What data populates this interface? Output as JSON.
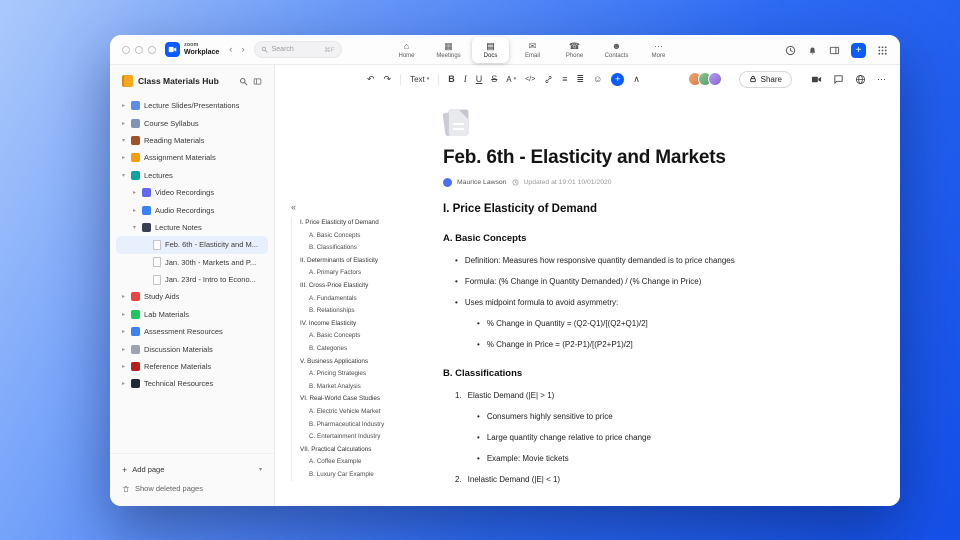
{
  "topbar": {
    "brand": {
      "line1": "zoom",
      "line2": "Workplace"
    },
    "nav_back": "‹",
    "nav_forward": "›",
    "search": {
      "placeholder": "Search",
      "shortcut": "⌘F"
    },
    "plus": "+",
    "tabs": [
      {
        "id": "home",
        "label": "Home",
        "icon": "⌂",
        "active": false
      },
      {
        "id": "meetings",
        "label": "Meetings",
        "icon": "▦",
        "active": false
      },
      {
        "id": "docs",
        "label": "Docs",
        "icon": "▤",
        "active": true
      },
      {
        "id": "email",
        "label": "Email",
        "icon": "✉",
        "active": false
      },
      {
        "id": "phone",
        "label": "Phone",
        "icon": "☎",
        "active": false
      },
      {
        "id": "contacts",
        "label": "Contacts",
        "icon": "☻",
        "active": false
      },
      {
        "id": "more",
        "label": "More",
        "icon": "⋯",
        "active": false
      }
    ]
  },
  "sidebar": {
    "title": "Class Materials Hub",
    "items": [
      {
        "label": "Lecture Slides/Presentations",
        "level": 0,
        "chevron": "right",
        "icon": "slides",
        "selected": false
      },
      {
        "label": "Course Syllabus",
        "level": 0,
        "chevron": "right",
        "icon": "syllabus",
        "selected": false
      },
      {
        "label": "Reading Materials",
        "level": 0,
        "chevron": "down",
        "icon": "reading",
        "selected": false
      },
      {
        "label": "Assignment Materials",
        "level": 0,
        "chevron": "right",
        "icon": "assignment",
        "selected": false
      },
      {
        "label": "Lectures",
        "level": 0,
        "chevron": "down",
        "icon": "lectures",
        "selected": false
      },
      {
        "label": "Video Recordings",
        "level": 1,
        "chevron": "right",
        "icon": "video",
        "selected": false
      },
      {
        "label": "Audio Recordings",
        "level": 1,
        "chevron": "right",
        "icon": "audio",
        "selected": false
      },
      {
        "label": "Lecture Notes",
        "level": 1,
        "chevron": "down",
        "icon": "notes",
        "selected": false
      },
      {
        "label": "Feb. 6th - Elasticity and M...",
        "level": 2,
        "chevron": null,
        "icon": "doc",
        "selected": true
      },
      {
        "label": "Jan. 30th - Markets and P...",
        "level": 2,
        "chevron": null,
        "icon": "doc",
        "selected": false
      },
      {
        "label": "Jan. 23rd - Intro to Econo...",
        "level": 2,
        "chevron": null,
        "icon": "doc",
        "selected": false
      },
      {
        "label": "Study Aids",
        "level": 0,
        "chevron": "right",
        "icon": "study",
        "selected": false
      },
      {
        "label": "Lab Materials",
        "level": 0,
        "chevron": "right",
        "icon": "lab",
        "selected": false
      },
      {
        "label": "Assessment Resources",
        "level": 0,
        "chevron": "right",
        "icon": "assessment",
        "selected": false
      },
      {
        "label": "Discussion Materials",
        "level": 0,
        "chevron": "right",
        "icon": "discussion",
        "selected": false
      },
      {
        "label": "Reference Materials",
        "level": 0,
        "chevron": "right",
        "icon": "reference",
        "selected": false
      },
      {
        "label": "Technical Resources",
        "level": 0,
        "chevron": "right",
        "icon": "technical",
        "selected": false
      }
    ],
    "footer": {
      "add_icon": "+",
      "add_page": "Add page",
      "caret": "▾",
      "show_deleted": "Show deleted pages"
    }
  },
  "doc_toolbar": {
    "undo": "↶",
    "redo": "↷",
    "text_style": "Text",
    "caret": "▾",
    "bold": "B",
    "italic": "I",
    "underline": "U",
    "strike": "S",
    "color": "A",
    "code": "</>",
    "list": "≡",
    "align": "≣",
    "emoji": "☺",
    "plus": "+",
    "collapse": "∧",
    "share": "Share",
    "more": "⋯"
  },
  "doc": {
    "title": "Feb. 6th - Elasticity and Markets",
    "author": "Maurice Lawson",
    "updated": "Updated at 19:01 10/01/2020",
    "outline_collapse": "«",
    "outline": [
      {
        "text": "I. Price Elasticity of Demand",
        "level": 0
      },
      {
        "text": "A. Basic Concepts",
        "level": 1
      },
      {
        "text": "B. Classifications",
        "level": 1
      },
      {
        "text": "II. Determinants of Elasticity",
        "level": 0
      },
      {
        "text": "A. Primary Factors",
        "level": 1
      },
      {
        "text": "III. Cross-Price Elasticity",
        "level": 0
      },
      {
        "text": "A. Fundamentals",
        "level": 1
      },
      {
        "text": "B. Relationships",
        "level": 1
      },
      {
        "text": "IV. Income Elasticity",
        "level": 0
      },
      {
        "text": "A. Basic Concepts",
        "level": 1
      },
      {
        "text": "B. Categories",
        "level": 1
      },
      {
        "text": "V. Business Applications",
        "level": 0
      },
      {
        "text": "A. Pricing Strategies",
        "level": 1
      },
      {
        "text": "B. Market Analysis",
        "level": 1
      },
      {
        "text": "VI. Real-World Case Studies",
        "level": 0
      },
      {
        "text": "A. Electric Vehicle Market",
        "level": 1
      },
      {
        "text": "B. Pharmaceutical Industry",
        "level": 1
      },
      {
        "text": "C. Entertainment Industry",
        "level": 1
      },
      {
        "text": "VII. Practical Calculations",
        "level": 0
      },
      {
        "text": "A. Coffee Example",
        "level": 1
      },
      {
        "text": "B. Luxury Car Example",
        "level": 1
      }
    ],
    "content": [
      {
        "type": "h2",
        "text": "I. Price Elasticity of Demand"
      },
      {
        "type": "h3",
        "text": "A. Basic Concepts"
      },
      {
        "type": "bullet",
        "level": 0,
        "text": "Definition: Measures how responsive quantity demanded is to price changes"
      },
      {
        "type": "bullet",
        "level": 0,
        "text": "Formula: (% Change in Quantity Demanded) / (% Change in Price)"
      },
      {
        "type": "bullet",
        "level": 0,
        "text": "Uses midpoint formula to avoid asymmetry:"
      },
      {
        "type": "bullet",
        "level": 1,
        "text": "% Change in Quantity = (Q2-Q1)/[(Q2+Q1)/2]"
      },
      {
        "type": "bullet",
        "level": 1,
        "text": "% Change in Price = (P2-P1)/[(P2+P1)/2]"
      },
      {
        "type": "h3",
        "text": "B. Classifications"
      },
      {
        "type": "num",
        "num": "1.",
        "text": "Elastic Demand (|E| > 1)"
      },
      {
        "type": "bullet",
        "level": 1,
        "text": "Consumers highly sensitive to price"
      },
      {
        "type": "bullet",
        "level": 1,
        "text": "Large quantity change relative to price change"
      },
      {
        "type": "bullet",
        "level": 1,
        "text": "Example: Movie tickets"
      },
      {
        "type": "num",
        "num": "2.",
        "text": "Inelastic Demand (|E| < 1)"
      }
    ]
  }
}
